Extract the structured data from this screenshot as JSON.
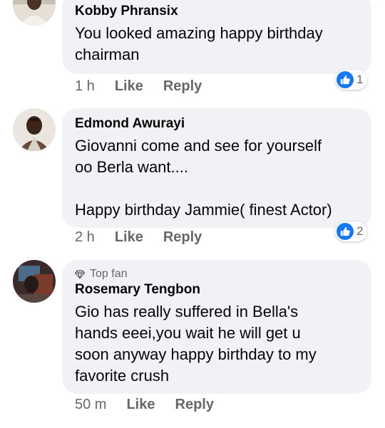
{
  "comments": [
    {
      "author": "Kobby Phransix",
      "text": "You looked amazing happy birthday\nchairman",
      "time": "1 h",
      "like_label": "Like",
      "reply_label": "Reply",
      "reaction_count": "1"
    },
    {
      "author": "Edmond Awurayi",
      "text": "Giovanni come and see for yourself\noo Berla want....\n\nHappy birthday Jammie( finest Actor)",
      "time": "2 h",
      "like_label": "Like",
      "reply_label": "Reply",
      "reaction_count": "2"
    },
    {
      "badge": "Top fan",
      "author": "Rosemary Tengbon",
      "text": "Gio has really suffered in Bella's\nhands eeei,you wait he will get u\nsoon anyway happy birthday to my\nfavorite crush",
      "time": "50 m",
      "like_label": "Like",
      "reply_label": "Reply"
    }
  ],
  "colors": {
    "bubble": "#f0f2f5",
    "like_blue": "#1877f2",
    "muted": "#65676b"
  }
}
